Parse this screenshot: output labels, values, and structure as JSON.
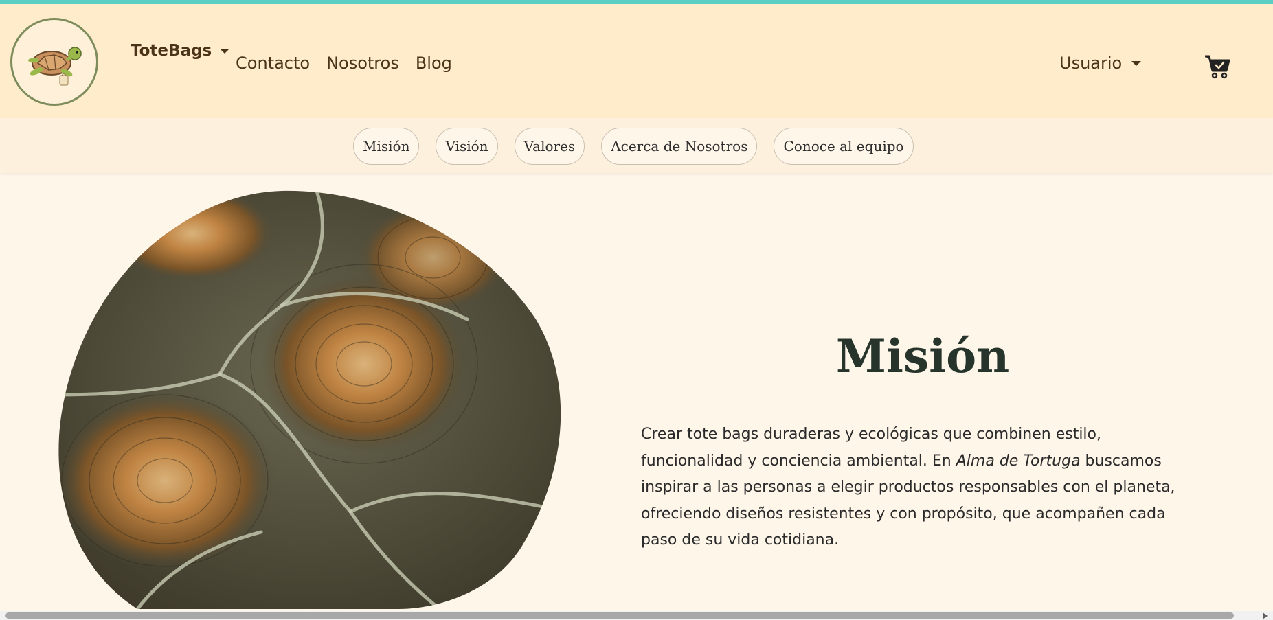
{
  "header": {
    "brand_label": "ToteBags",
    "nav_links": [
      "Contacto",
      "Nosotros",
      "Blog"
    ],
    "user_label": "Usuario",
    "logo_icon": "turtle-logo-icon",
    "cart_icon": "shopping-cart-icon"
  },
  "subnav": {
    "pills": [
      "Misión",
      "Visión",
      "Valores",
      "Acerca de Nosotros",
      "Conoce al equipo"
    ]
  },
  "mission": {
    "title": "Misión",
    "text_part1": "Crear tote bags duraderas y ecológicas que combinen estilo, funcionalidad y conciencia ambiental. En ",
    "text_brand": "Alma de Tortuga",
    "text_part2": " buscamos inspirar a las personas a elegir productos responsables con el planeta, ofreciendo diseños resistentes y con propósito, que acompañen cada paso de su vida cotidiana.",
    "image_icon": "turtle-shell-image"
  },
  "colors": {
    "accent_strip": "#5ccfc4",
    "navbar_bg": "#ffeccb",
    "page_bg": "#fff6ea",
    "text_brown": "#4a3318",
    "title_green": "#26342b"
  }
}
